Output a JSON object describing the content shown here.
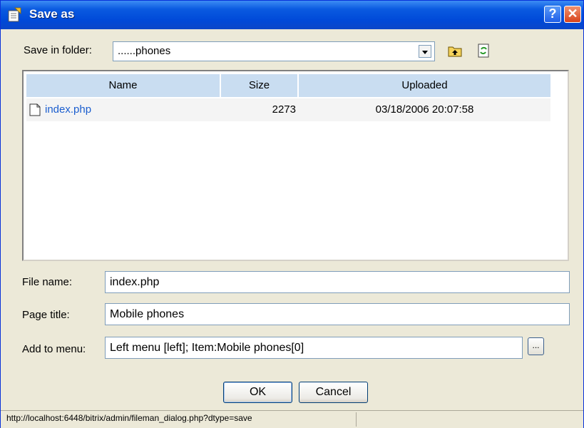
{
  "window": {
    "title": "Save as",
    "help_label": "?",
    "close_label": "✕"
  },
  "folder": {
    "label": "Save in folder:",
    "value": "......phones",
    "icons": [
      "folder-up-icon",
      "refresh-icon"
    ]
  },
  "file_list": {
    "columns": [
      "Name",
      "Size",
      "Uploaded"
    ],
    "rows": [
      {
        "name": "index.php",
        "size": "2273",
        "uploaded": "03/18/2006 20:07:58",
        "icon": "document-icon"
      }
    ]
  },
  "form": {
    "file_name_label": "File name:",
    "file_name_value": "index.php",
    "page_title_label": "Page title:",
    "page_title_value": "Mobile phones",
    "menu_label": "Add to menu:",
    "menu_value": "Left menu [left]; Item:Mobile phones[0]",
    "browse_label": "..."
  },
  "buttons": {
    "ok": "OK",
    "cancel": "Cancel"
  },
  "status": {
    "text": "http://localhost:6448/bitrix/admin/fileman_dialog.php?dtype=save"
  },
  "colors": {
    "titlebar": "#0a5ae0",
    "link": "#1b5ecf",
    "header": "#c9ddf1",
    "dialog_bg": "#ece9d8"
  }
}
